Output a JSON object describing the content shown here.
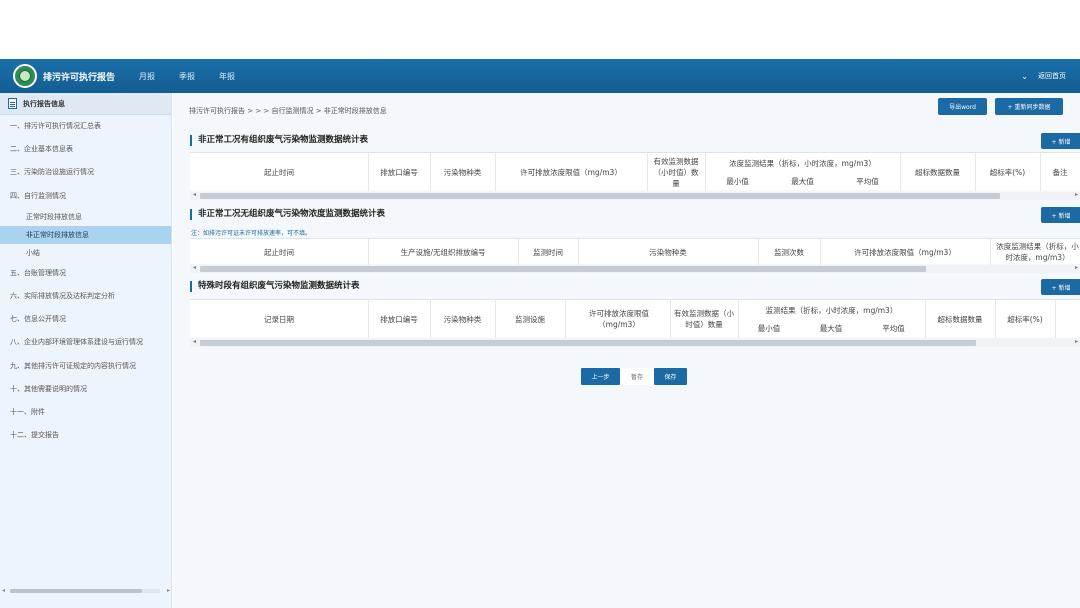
{
  "header": {
    "title": "排污许可执行报告",
    "nav": [
      "月报",
      "季报",
      "年报"
    ],
    "back_home": "返回首页"
  },
  "sidebar": {
    "title": "执行报告信息",
    "items": [
      "一、排污许可执行情况汇总表",
      "二、企业基本信息表",
      "三、污染防治设施运行情况",
      "四、自行监测情况",
      "正常时段排放信息",
      "非正常时段排放信息",
      "小结",
      "五、台账管理情况",
      "六、实际排放情况及达标判定分析",
      "七、信息公开情况",
      "八、企业内部环境管理体系建设与运行情况",
      "九、其他排污许可证规定的内容执行情况",
      "十、其他需要说明的情况",
      "十一、附件",
      "十二、提交报告"
    ]
  },
  "breadcrumb": "排污许可执行报告 > > > 自行监测情况 > 非正常时段排放信息",
  "buttons": {
    "export_word": "导出word",
    "resync": "+ 重新同步数据",
    "add": "+ 新增",
    "prev": "上一步",
    "draft": "暂存",
    "save": "保存"
  },
  "tables": [
    {
      "title": "非正常工况有组织废气污染物监测数据统计表",
      "headers": [
        "起止时间",
        "排放口编号",
        "污染物种类",
        "许可排放浓度限值（mg/m3）",
        "有效监测数据（小时值）数量",
        "浓度监测结果（折标，小时浓度，mg/m3）",
        "最小值",
        "最大值",
        "平均值",
        "超标数据数量",
        "超标率(%)",
        "备注"
      ]
    },
    {
      "title": "非正常工况无组织废气污染物浓度监测数据统计表",
      "note": "注：如排污许可证未许可排放速率，可不填。",
      "headers": [
        "起止时间",
        "生产设施/无组织排放编号",
        "监测时间",
        "污染物种类",
        "监测次数",
        "许可排放浓度限值（mg/m3）",
        "浓度监测结果（折标，小时浓度，mg/m3）"
      ]
    },
    {
      "title": "特殊时段有组织废气污染物监测数据统计表",
      "headers": [
        "记录日期",
        "排放口编号",
        "污染物种类",
        "监测设施",
        "许可排放浓度限值（mg/m3）",
        "有效监测数据（小时值）数量",
        "监测结果（折标，小时浓度，mg/m3）",
        "最小值",
        "最大值",
        "平均值",
        "超标数据数量",
        "超标率(%)"
      ]
    }
  ],
  "colors": {
    "header_bg": "#1b6fa8",
    "accent": "#1c6aa3",
    "active_item": "#a9d3ee"
  }
}
